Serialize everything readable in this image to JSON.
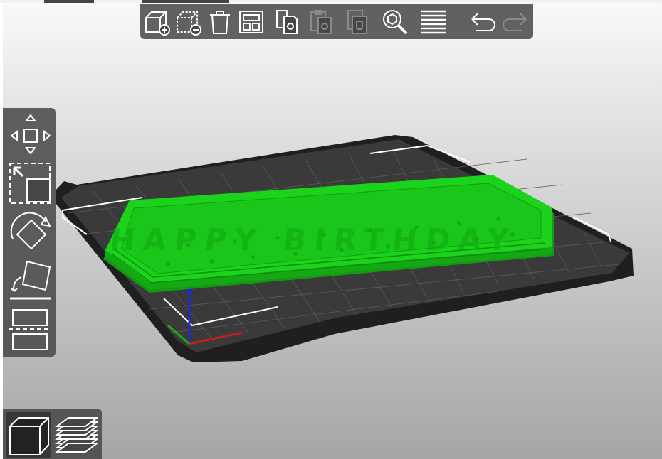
{
  "colors": {
    "model": "#1bd31b",
    "bed": "#2b2b2b",
    "toolbar_bg": "#464646",
    "icon_active": "#ffffff",
    "icon_disabled": "#8a8a8a"
  },
  "toolbar_top": {
    "buttons": [
      {
        "icon": "add-icon",
        "enabled": true
      },
      {
        "icon": "delete-icon",
        "enabled": true
      },
      {
        "icon": "delete-all-icon",
        "enabled": true
      },
      {
        "icon": "arrange-icon",
        "enabled": true
      },
      {
        "icon": "copy-icon",
        "enabled": true
      },
      {
        "icon": "paste-icon",
        "enabled": false
      },
      {
        "icon": "instance-add-icon",
        "enabled": false
      },
      {
        "icon": "search-icon",
        "enabled": true
      },
      {
        "icon": "layers-editing-icon",
        "enabled": true
      },
      {
        "icon": "undo-icon",
        "enabled": true
      },
      {
        "icon": "redo-icon",
        "enabled": false
      }
    ]
  },
  "toolbar_left": {
    "tools": [
      "move-icon",
      "scale-icon",
      "rotate-icon",
      "place-on-face-icon",
      "cut-icon"
    ]
  },
  "view_toolbar": {
    "buttons": [
      {
        "icon": "3d-view-icon",
        "active": true
      },
      {
        "icon": "preview-layers-icon",
        "active": false
      }
    ]
  },
  "scene": {
    "model_text": "HAPPY BIRTHDAY"
  }
}
